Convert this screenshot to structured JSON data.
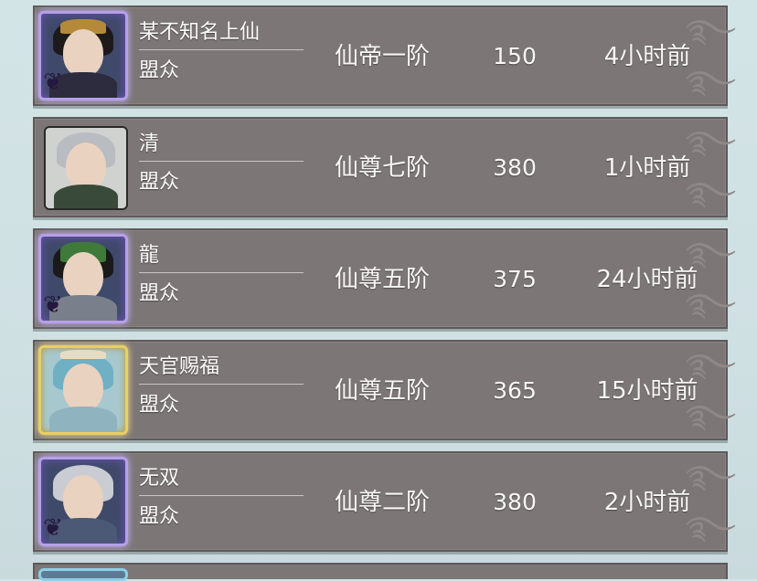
{
  "members": [
    {
      "name": "某不知名上仙",
      "role": "盟众",
      "rank": "仙帝一阶",
      "power": "150",
      "last_online": "4小时前",
      "frame": "purple"
    },
    {
      "name": "清",
      "role": "盟众",
      "rank": "仙尊七阶",
      "power": "380",
      "last_online": "1小时前",
      "frame": "plain"
    },
    {
      "name": "龍",
      "role": "盟众",
      "rank": "仙尊五阶",
      "power": "375",
      "last_online": "24小时前",
      "frame": "purple"
    },
    {
      "name": "天官赐福",
      "role": "盟众",
      "rank": "仙尊五阶",
      "power": "365",
      "last_online": "15小时前",
      "frame": "gold"
    },
    {
      "name": "无双",
      "role": "盟众",
      "rank": "仙尊二阶",
      "power": "380",
      "last_online": "2小时前",
      "frame": "purple"
    }
  ],
  "colors": {
    "row_bg": "#7c7676",
    "page_bg": "#d3e4e6",
    "text": "#fbfbfb"
  }
}
